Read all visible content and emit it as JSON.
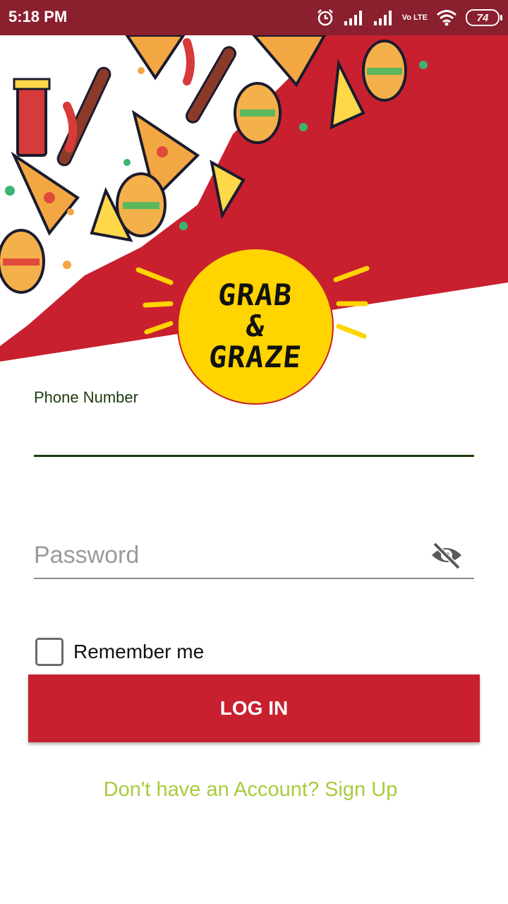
{
  "status_bar": {
    "time": "5:18 PM",
    "network_type": "Vo LTE",
    "battery_level": "74"
  },
  "brand": {
    "logo_line1": "GRAB",
    "logo_line2": "&",
    "logo_line3": "GRAZE"
  },
  "form": {
    "phone_label": "Phone Number",
    "phone_value": "",
    "password_placeholder": "Password",
    "password_value": "",
    "remember_label": "Remember me",
    "remember_checked": false,
    "login_label": "LOG IN",
    "signup_text": "Don't have an Account? Sign Up"
  },
  "colors": {
    "status_bar": "#8a1f2e",
    "brand_red": "#c8202f",
    "logo_yellow": "#ffd400",
    "field_focus": "#1d3b0e",
    "link_green": "#a8cc3c"
  },
  "icons": {
    "alarm": "alarm-icon",
    "signal": "signal-icon",
    "wifi": "wifi-icon",
    "battery": "battery-icon",
    "password_toggle": "eye-off-icon"
  }
}
